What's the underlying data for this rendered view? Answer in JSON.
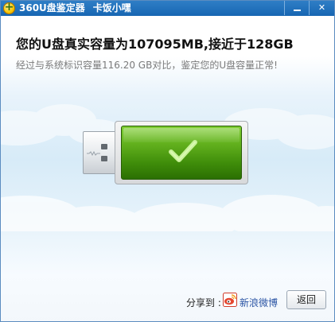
{
  "window": {
    "title": "360U盘鉴定器",
    "subtitle": "卡饭小嘿"
  },
  "result": {
    "headline": "您的U盘真实容量为107095MB,接近于128GB",
    "detail": "经过与系统标识容量116.20 GB对比，鉴定您的U盘容量正常!"
  },
  "footer": {
    "share_label": "分享到 :",
    "weibo_label": "新浪微博",
    "back_label": "返回"
  },
  "icons": {
    "app": "360-logo-icon",
    "status": "checkmark-icon",
    "device": "usb-drive-icon",
    "share": "sina-weibo-icon"
  },
  "colors": {
    "titlebar": "#1f6fbc",
    "drive_green": "#4f9f12",
    "link_blue": "#2a54a4"
  }
}
